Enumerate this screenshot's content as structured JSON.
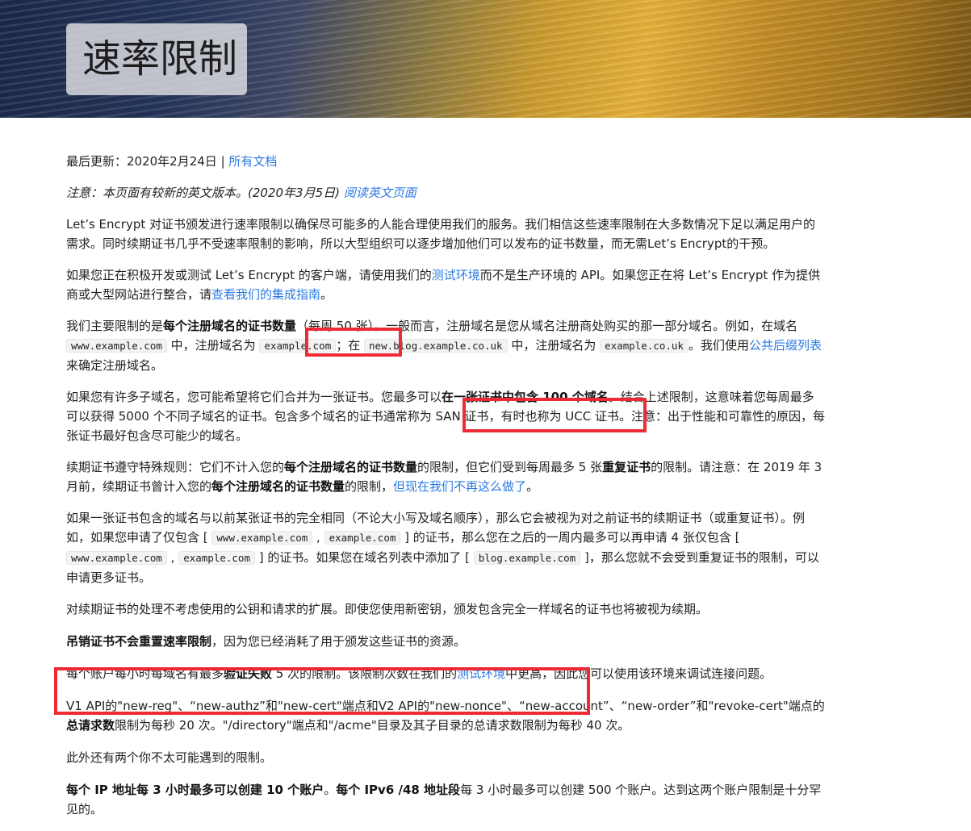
{
  "hero": {
    "title": "速率限制"
  },
  "meta": {
    "updated": "最后更新：2020年2月24日 | ",
    "all_docs": "所有文档"
  },
  "notice": {
    "text": "注意：本页面有较新的英文版本。(2020年3月5日) ",
    "link": "阅读英文页面"
  },
  "p_intro": "Let’s Encrypt 对证书颁发进行速率限制以确保尽可能多的人能合理使用我们的服务。我们相信这些速率限制在大多数情况下足以满足用户的需求。同时续期证书几乎不受速率限制的影响，所以大型组织可以逐步增加他们可以发布的证书数量，而无需Let’s Encrypt的干预。",
  "p_staging": {
    "t1": "如果您正在积极开发或测试 Let’s Encrypt 的客户端，请使用我们的",
    "link1": "测试环境",
    "t2": "而不是生产环境的 API。如果您正在将 Let’s Encrypt 作为提供商或大型网站进行整合，请",
    "link2": "查看我们的集成指南",
    "t3": "。"
  },
  "p_main": {
    "t1": "我们主要限制的是",
    "b1": "每个注册域名的证书数量",
    "t2": "（每周 50 张）。一般而言，注册域名是您从域名注册商处购买的那一部分域名。例如，在域名 ",
    "c1": "www.example.com",
    "t3": " 中，注册域名为 ",
    "c2": "example.com",
    "t4": "；在 ",
    "c3": "new.blog.example.co.uk",
    "t5": " 中，注册域名为 ",
    "c4": "example.co.uk",
    "t6": "。我们使用",
    "link": "公共后缀列表",
    "t7": "来确定注册域名。"
  },
  "p_subdomains": {
    "t1": "如果您有许多子域名，您可能希望将它们合并为一张证书。您最多可以",
    "b1": "在一张证书中包含 100 个域名",
    "t2": "。结合上述限制，这意味着您每周最多可以获得 5000 个不同子域名的证书。包含多个域名的证书通常称为 SAN 证书，有时也称为 UCC 证书。注意：出于性能和可靠性的原因，每张证书最好包含尽可能少的域名。"
  },
  "p_renewal": {
    "t1": "续期证书遵守特殊规则：它们不计入您的",
    "b1": "每个注册域名的证书数量",
    "t2": "的限制，但它们受到每周最多 5 张",
    "b2": "重复证书",
    "t3": "的限制。请注意：在 2019 年 3 月前，续期证书曾计入您的",
    "b3": "每个注册域名的证书数量",
    "t4": "的限制，",
    "link": "但现在我们不再这么做了",
    "t5": "。"
  },
  "p_duplicate": {
    "t1": "如果一张证书包含的域名与以前某张证书的完全相同（不论大小写及域名顺序），那么它会被视为对之前证书的续期证书（或重复证书）。例如，如果您申请了仅包含 [ ",
    "c1": "www.example.com",
    "t2": " , ",
    "c2": "example.com",
    "t3": " ] 的证书，那么您在之后的一周内最多可以再申请 4 张仅包含 [ ",
    "c3": "www.example.com",
    "t4": " , ",
    "c4": "example.com",
    "t5": " ] 的证书。如果您在域名列表中添加了 [ ",
    "c5": "blog.example.com",
    "t6": " ]，那么您就不会受到重复证书的限制，可以申请更多证书。"
  },
  "p_keys": "对续期证书的处理不考虑使用的公钥和请求的扩展。即使您使用新密钥，颁发包含完全一样域名的证书也将被视为续期。",
  "p_revoke": {
    "b1": "吊销证书不会重置速率限制",
    "t1": "，因为您已经消耗了用于颁发这些证书的资源。"
  },
  "p_failed": {
    "t1": "每个账户每小时每域名有最多",
    "b1": "验证失败",
    "t2": " 5 次的限制。该限制次数在我们的",
    "link": "测试环境",
    "t3": "中更高，因此您可以使用该环境来调试连接问题。"
  },
  "p_api": {
    "t1": "V1 API的\"new-reg\"、“new-authz”和\"new-cert\"端点和V2 API的\"new-nonce\"、“new-account”、“new-order”和\"revoke-cert\"端点的",
    "b1": "总请求数",
    "t2": "限制为每秒 20 次。\"/directory\"端点和\"/acme\"目录及其子目录的总请求数限制为每秒 40 次。"
  },
  "p_other": "此外还有两个你不太可能遇到的限制。",
  "p_ip": {
    "b1": "每个 IP 地址每 3 小时最多可以创建 10 个账户",
    "t1": "。",
    "b2": "每个 IPv6 /48 地址段",
    "t2": "每 3 小时最多可以创建 500 个账户。达到这两个账户限制是十分罕见的。"
  },
  "colors": {
    "highlight_box": "#ee2b35",
    "link": "#2a7ae2"
  }
}
